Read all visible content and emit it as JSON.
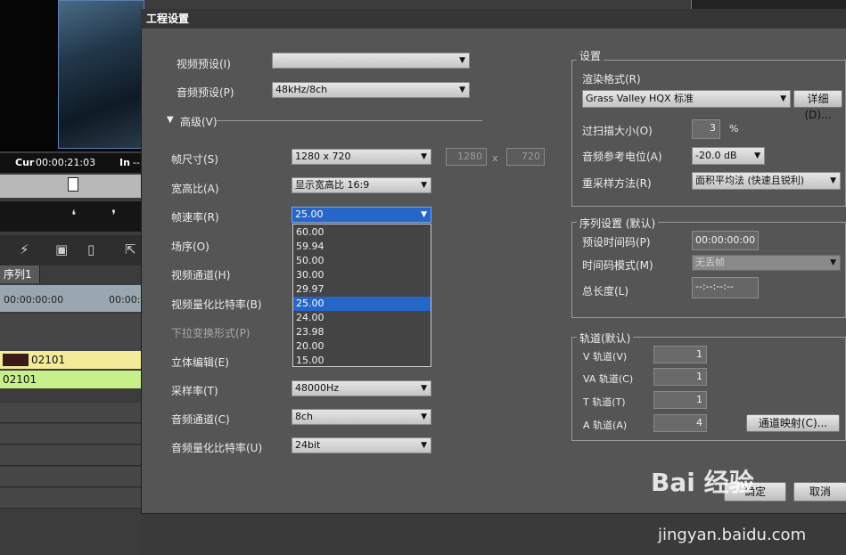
{
  "background_app": {
    "timecode_label": "Cur",
    "timecode_value": "00:00:21:03",
    "in_label": "In",
    "in_value": "--",
    "sequence_tab": "序列1",
    "ruler_start": "00:00:00:00",
    "ruler_next": "00:00:",
    "clip1_name": "02101",
    "clip2_name": "02101"
  },
  "dialog": {
    "title": "工程设置",
    "left": {
      "video_preset_label": "视频预设(I)",
      "video_preset_value": "",
      "audio_preset_label": "音频预设(P)",
      "audio_preset_value": "48kHz/8ch",
      "advanced_label": "高级(V)",
      "frame_size_label": "帧尺寸(S)",
      "frame_size_value": "1280 x 720",
      "frame_width": "1280",
      "frame_x": "x",
      "frame_height": "720",
      "aspect_label": "宽高比(A)",
      "aspect_value": "显示宽高比 16:9",
      "fps_label": "帧速率(R)",
      "fps_value": "25.00",
      "field_order_label": "场序(O)",
      "video_channel_label": "视频通道(H)",
      "video_bitdepth_label": "视频量化比特率(B)",
      "pulldown_label": "下拉变换形式(P)",
      "stereo_label": "立体编辑(E)",
      "sample_rate_label": "采样率(T)",
      "sample_rate_value": "48000Hz",
      "audio_channel_label": "音频通道(C)",
      "audio_channel_value": "8ch",
      "audio_bitdepth_label": "音频量化比特率(U)",
      "audio_bitdepth_value": "24bit",
      "fps_options": [
        "60.00",
        "59.94",
        "50.00",
        "30.00",
        "29.97",
        "25.00",
        "24.00",
        "23.98",
        "20.00",
        "15.00"
      ],
      "fps_selected_index": 5
    },
    "settings": {
      "group_title": "设置",
      "render_format_label": "渲染格式(R)",
      "render_format_value": "Grass Valley HQX 标准",
      "details_button": "详细(D)...",
      "overscan_label": "过扫描大小(O)",
      "overscan_value": "3",
      "overscan_unit": "%",
      "audio_ref_label": "音频参考电位(A)",
      "audio_ref_value": "-20.0 dB",
      "resample_label": "重采样方法(R)",
      "resample_value": "面积平均法 (快速且锐利)"
    },
    "sequence": {
      "group_title": "序列设置 (默认)",
      "preset_tc_label": "预设时间码(P)",
      "preset_tc_value": "00:00:00:00",
      "tc_mode_label": "时间码模式(M)",
      "tc_mode_value": "无丢帧",
      "total_length_label": "总长度(L)",
      "total_length_value": "--:--:--:--"
    },
    "tracks": {
      "group_title": "轨道(默认)",
      "v_label": "V 轨道(V)",
      "v_value": "1",
      "va_label": "VA 轨道(C)",
      "va_value": "1",
      "t_label": "T 轨道(T)",
      "t_value": "1",
      "a_label": "A 轨道(A)",
      "a_value": "4",
      "mapping_button": "通道映射(C)..."
    },
    "ok_button": "确定",
    "cancel_button": "取消"
  },
  "watermark": {
    "logo": "Bai 经验",
    "url": "jingyan.baidu.com"
  }
}
